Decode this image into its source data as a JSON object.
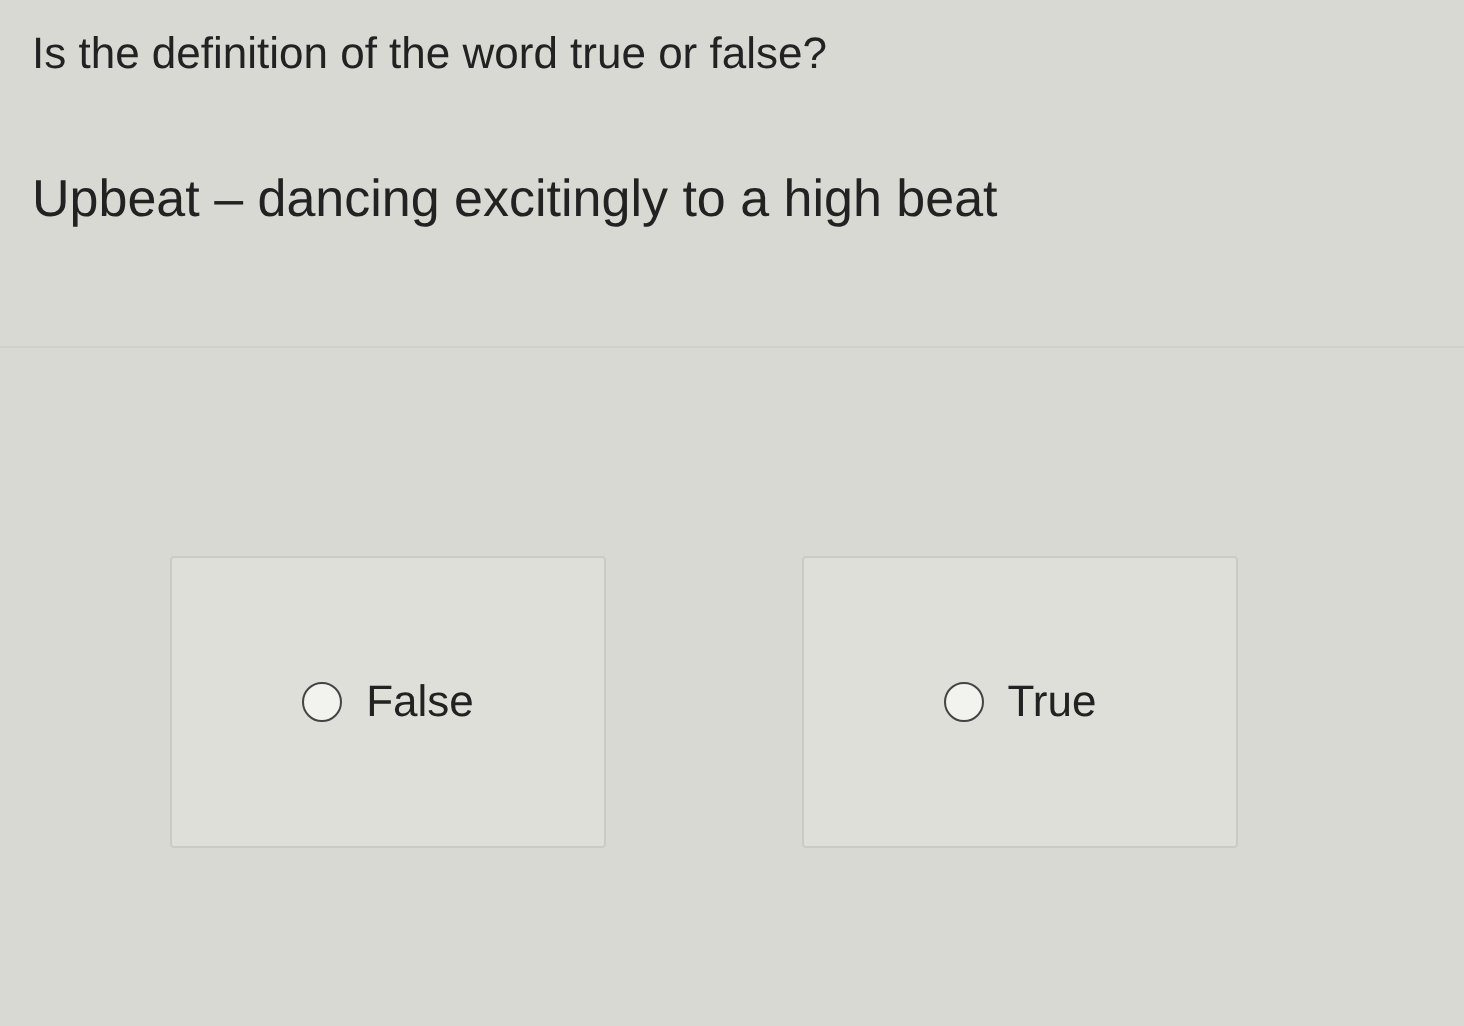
{
  "question": "Is the definition of the word true or false?",
  "statement": "Upbeat – dancing excitingly to a high beat",
  "options": [
    {
      "label": "False",
      "selected": false
    },
    {
      "label": "True",
      "selected": false
    }
  ]
}
